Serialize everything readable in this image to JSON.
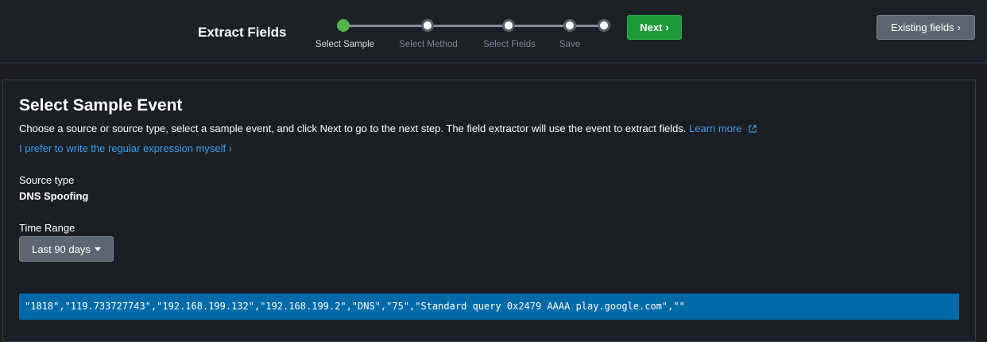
{
  "header": {
    "title": "Extract Fields",
    "steps": [
      {
        "label": "Select Sample",
        "active": true
      },
      {
        "label": "Select Method",
        "active": false
      },
      {
        "label": "Select Fields",
        "active": false
      },
      {
        "label": "Save",
        "active": false
      }
    ],
    "next_label": "Next",
    "existing_fields_label": "Existing fields"
  },
  "panel": {
    "title": "Select Sample Event",
    "description": "Choose a source or source type, select a sample event, and click Next to go to the next step. The field extractor will use the event to extract fields.",
    "learn_more": "Learn more",
    "regex_link": "I prefer to write the regular expression myself",
    "source_type_label": "Source type",
    "source_type_value": "DNS Spoofing",
    "time_range_label": "Time Range",
    "time_range_value": "Last 90 days",
    "sample_event": "\"1818\",\"119.733727743\",\"192.168.199.132\",\"192.168.199.2\",\"DNS\",\"75\",\"Standard query 0x2479 AAAA play.google.com\",\"\""
  },
  "colors": {
    "accent_green": "#1c9a3a",
    "step_active": "#53b44c",
    "link_blue": "#3aa0f0",
    "selected_event_bg": "#006aa8"
  },
  "icons": [
    "chevron-right-icon",
    "external-link-icon",
    "caret-down-icon"
  ]
}
